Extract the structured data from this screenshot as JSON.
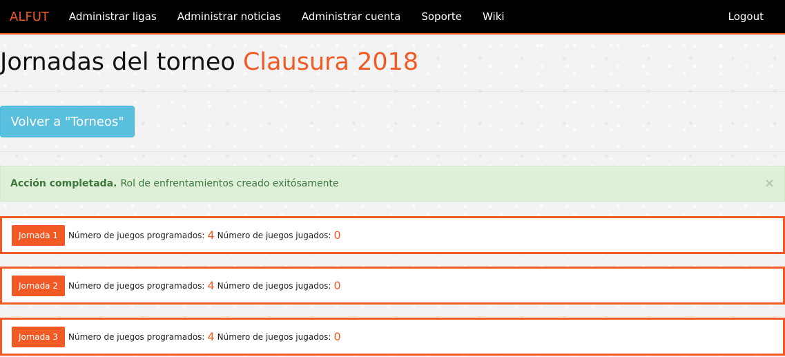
{
  "navbar": {
    "brand": "ALFUT",
    "items": [
      "Administrar ligas",
      "Administrar noticias",
      "Administrar cuenta",
      "Soporte",
      "Wiki"
    ],
    "logout": "Logout"
  },
  "header": {
    "title_prefix": "Jornadas del torneo",
    "title_tournament": "Clausura 2018"
  },
  "back_button": {
    "label": "Volver a \"Torneos\""
  },
  "alert": {
    "strong": "Acción completada.",
    "message": "Rol de enfrentamientos creado exitósamente",
    "close": "×"
  },
  "jornadas": [
    {
      "label": "Jornada 1",
      "programados_label": "Número de juegos programados:",
      "programados": "4",
      "jugados_label": "Número de juegos jugados:",
      "jugados": "0"
    },
    {
      "label": "Jornada 2",
      "programados_label": "Número de juegos programados:",
      "programados": "4",
      "jugados_label": "Número de juegos jugados:",
      "jugados": "0"
    },
    {
      "label": "Jornada 3",
      "programados_label": "Número de juegos programados:",
      "programados": "4",
      "jugados_label": "Número de juegos jugados:",
      "jugados": "0"
    }
  ],
  "colors": {
    "accent": "#f15a24",
    "info": "#5bc0de",
    "success_bg": "#dff0d8"
  }
}
